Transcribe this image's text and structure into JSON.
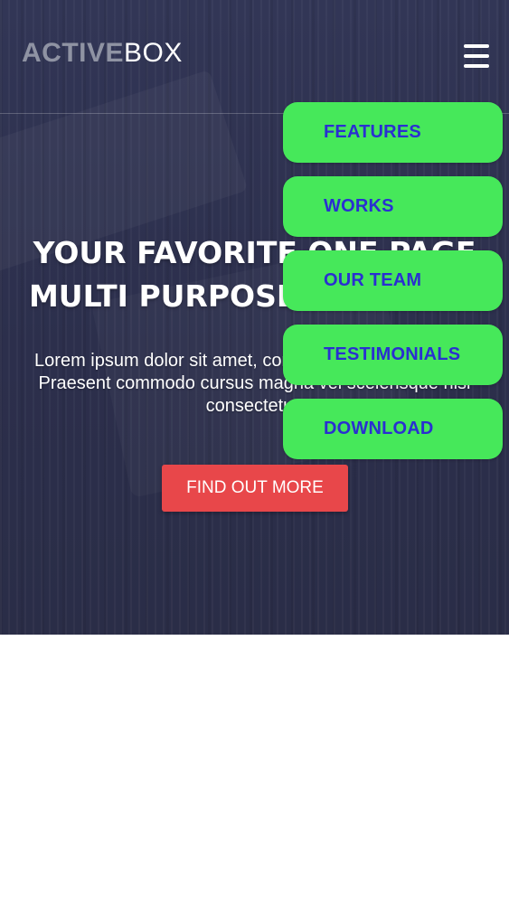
{
  "brand": {
    "name_primary": "ACTIVE",
    "name_secondary": "BOX"
  },
  "hero": {
    "headline_line1": "YOUR FAVORITE ONE PAGE",
    "headline_line2": "MULTI PURPOSE TEMPLATE",
    "lead": "Lorem ipsum dolor sit amet, consectetur adipiscing elit. Praesent commodo cursus magna vel scelerisque nisl consectetur.",
    "cta_label": "FIND OUT MORE"
  },
  "menu": {
    "items": [
      {
        "label": "FEATURES"
      },
      {
        "label": "WORKS"
      },
      {
        "label": "OUR TEAM"
      },
      {
        "label": "TESTIMONIALS"
      },
      {
        "label": "DOWNLOAD"
      }
    ]
  },
  "icons": {
    "menu_toggle": "hamburger-icon"
  },
  "colors": {
    "hero_bg": "#2e3150",
    "cta_bg": "#e8474a",
    "menu_item_bg": "#46e85a",
    "menu_item_text": "#2a2fd1",
    "logo_muted": "#8f93a3"
  }
}
